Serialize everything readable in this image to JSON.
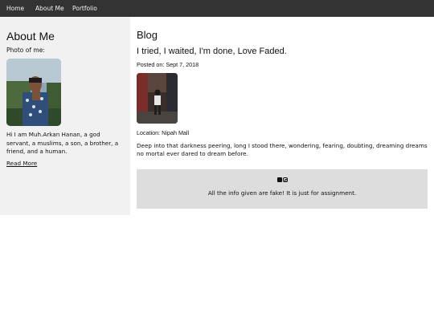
{
  "nav": {
    "items": [
      "Home",
      "About Me",
      "Portfolio"
    ]
  },
  "sidebar": {
    "title": "About Me",
    "photo_label": "Photo of me:",
    "bio": "Hi I am Muh.Arkan Hanan, a god servant, a muslims, a son, a brother, a friend, and a human.",
    "read_more": "Read More"
  },
  "main": {
    "heading": "Blog",
    "post": {
      "title": "I tried, I waited, I'm done, Love Faded.",
      "date": "Posted on: Sept 7, 2018",
      "location": "Location: Nipah Mall",
      "body": "Deep into that darkness peering, long I stood there, wondering, fearing, doubting, dreaming dreams no mortal ever dared to dream before."
    }
  },
  "footer": {
    "icons": [
      "facebook-icon",
      "instagram-icon"
    ],
    "text": "All the info given are fake! It is just for assignment."
  },
  "colors": {
    "navbar": "#333333",
    "nav_text": "#f2f2f2",
    "sidebar": "#f1f1f1",
    "footer": "#dddddd"
  }
}
